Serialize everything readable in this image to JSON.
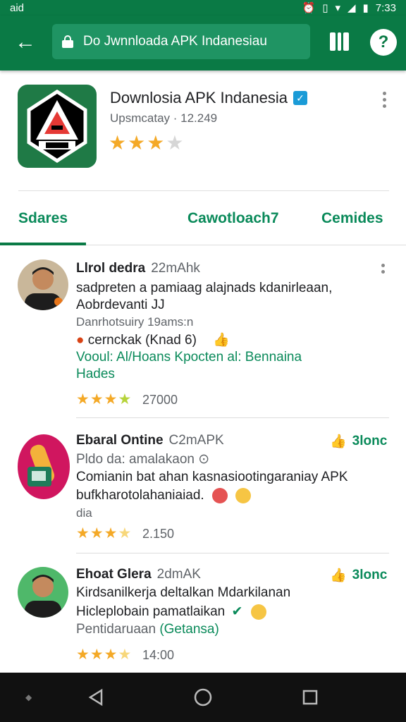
{
  "status_bar": {
    "left_text": "aid",
    "time": "7:33"
  },
  "app_bar": {
    "url_text": "Do Jwnnloada APK Indanesiau",
    "back_icon": "arrow-left-icon",
    "tabs_icon": "tabs-icon",
    "help_icon": "help-icon"
  },
  "app": {
    "title": "Downlosia APK Indanesia",
    "subtitle": "Upsmcatay · 12.249",
    "rating_stars": 3,
    "rating_max": 4
  },
  "tabs": [
    {
      "label": "Sdares",
      "active": true
    },
    {
      "label": "Cawotloach7",
      "active": false
    },
    {
      "label": "Cemides",
      "active": false
    }
  ],
  "reviews": [
    {
      "name": "Llrol dedra",
      "meta": "22mAhk",
      "line1": "sadpreten a pamiaag alajnads kdanirleaan,",
      "line2": "Aobrdevanti JJ",
      "line3": "Danrhotsuiry 19ams:n",
      "line4": "cernckak (Knad 6)",
      "line5": "Vooul: Al/Hoans Kpocten al: Bennaina",
      "line6": "Hades",
      "stars": 3.5,
      "count": "27000"
    },
    {
      "name": "Ebaral Ontine",
      "meta": "C2mAPK",
      "like_label": "3lonc",
      "line1": "Pldo da: amalakaon",
      "line2": "Comianin bat ahan kasnasiootingaraniay APK",
      "line3": "bufkharotolahaniaiad.",
      "line4": "dia",
      "stars": 3.5,
      "count": "2.150"
    },
    {
      "name": "Ehoat Glera",
      "meta": "2dmAK",
      "like_label": "3lonc",
      "line1": "Kirdsanilkerja deltalkan Mdarkilanan",
      "line2": "Hicleplobain pamatlaikan",
      "line3": "Pentidaruaan",
      "line3_green": "(Getansa)",
      "stars": 3.5,
      "count": "14:00"
    }
  ],
  "colors": {
    "primary": "#0a7a45",
    "accent": "#0a8a5a",
    "star": "#f4a927"
  }
}
